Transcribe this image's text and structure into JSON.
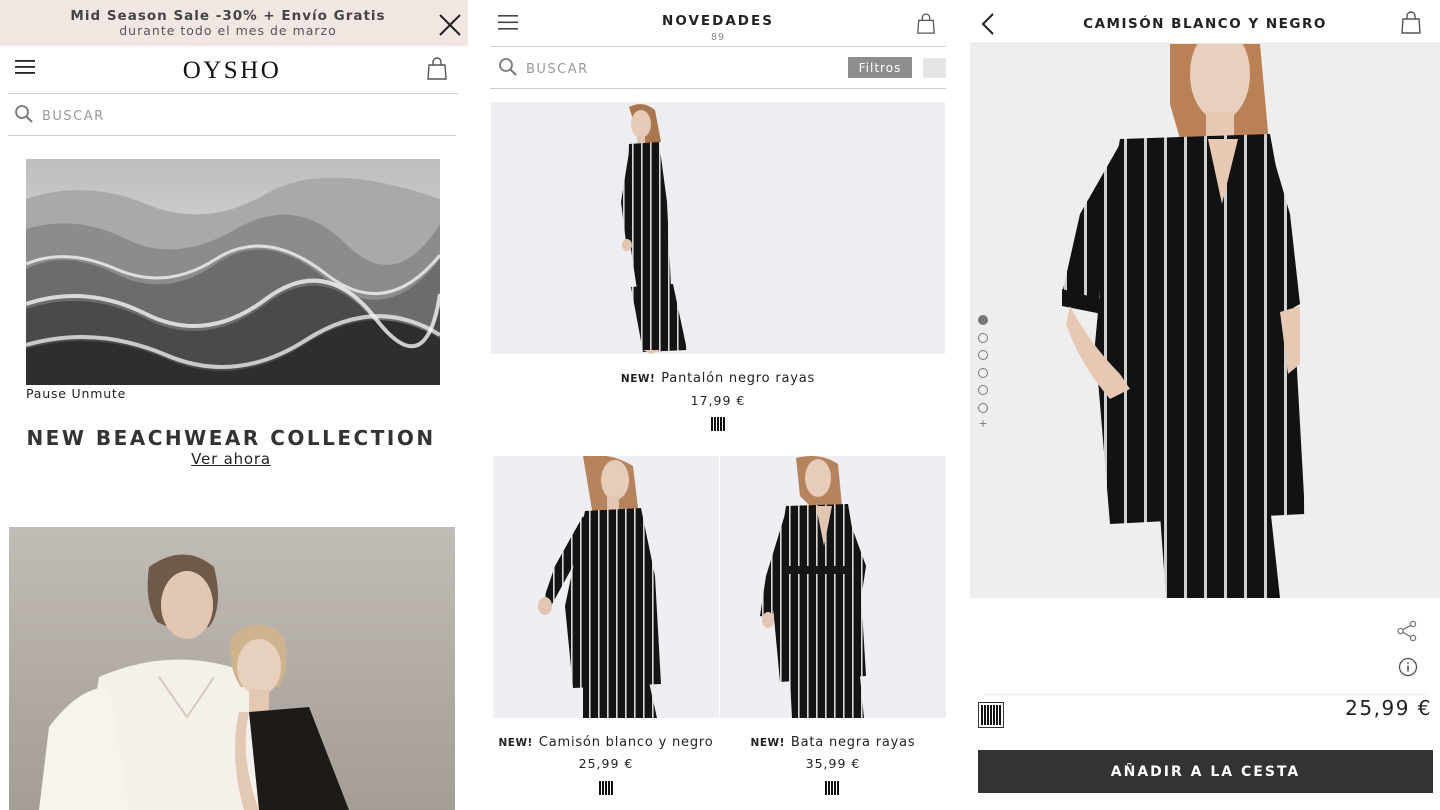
{
  "screen_home": {
    "promo": {
      "line1": "Mid Season Sale -30% + Envío Gratis",
      "line2": "durante todo el mes de marzo",
      "close_icon": "close-icon"
    },
    "header": {
      "menu_icon": "hamburger-icon",
      "logo": "OYSHO",
      "bag_icon": "shopping-bag-icon"
    },
    "search": {
      "placeholder": "BUSCAR",
      "icon": "search-icon"
    },
    "video": {
      "pause_label": "Pause",
      "unmute_label": "Unmute"
    },
    "collection": {
      "title": "NEW BEACHWEAR COLLECTION",
      "link": "Ver ahora"
    }
  },
  "screen_list": {
    "header": {
      "menu_icon": "hamburger-icon",
      "title": "NOVEDADES",
      "count": "89",
      "bag_icon": "shopping-bag-icon"
    },
    "search": {
      "placeholder": "BUSCAR",
      "icon": "search-icon"
    },
    "filters_label": "Filtros",
    "products": [
      {
        "badge": "NEW!",
        "name": "Pantalón negro rayas",
        "price": "17,99 €"
      },
      {
        "badge": "NEW!",
        "name": "Camisón blanco y negro",
        "price": "25,99 €"
      },
      {
        "badge": "NEW!",
        "name": "Bata negra rayas",
        "price": "35,99 €"
      }
    ]
  },
  "screen_detail": {
    "header": {
      "back_icon": "chevron-left-icon",
      "title": "CAMISÓN BLANCO Y NEGRO",
      "bag_icon": "shopping-bag-icon"
    },
    "gallery": {
      "image_count": 6,
      "active_index": 0,
      "more_label": "+"
    },
    "share_icon": "share-icon",
    "info_icon": "info-icon",
    "price": "25,99 €",
    "add_to_cart": "AÑADIR A LA CESTA"
  },
  "colors": {
    "promo_bg": "#f1e7e2",
    "filters_btn": "#8e8e8e",
    "cart_btn": "#333333",
    "text": "#222222"
  }
}
